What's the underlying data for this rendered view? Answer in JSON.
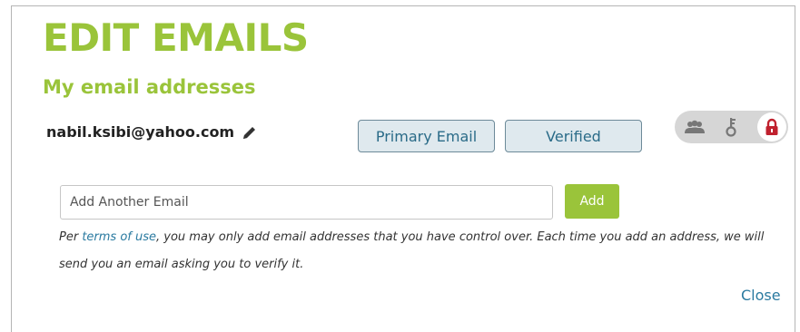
{
  "dialog": {
    "title": "EDIT EMAILS",
    "subtitle": "My email addresses",
    "close_label": "Close"
  },
  "email_entry": {
    "address": "nabil.ksibi@yahoo.com",
    "edit_icon": "pencil-icon",
    "primary_label": "Primary Email",
    "verified_label": "Verified"
  },
  "visibility_toggle": {
    "icons": [
      "users-icon",
      "key-icon",
      "lock-icon"
    ],
    "selected": "lock-icon",
    "selected_color": "#c0212e"
  },
  "add_form": {
    "placeholder": "Add Another Email",
    "button_label": "Add"
  },
  "note": {
    "prefix": "Per ",
    "link_text": "terms of use",
    "suffix": ", you may only add email addresses that you have control over. Each time you add an address, we will send you an email asking you to verify it."
  },
  "colors": {
    "accent_green": "#9ac43a",
    "link_blue": "#2a7aa0",
    "chip_bg": "#dfe9ee"
  }
}
